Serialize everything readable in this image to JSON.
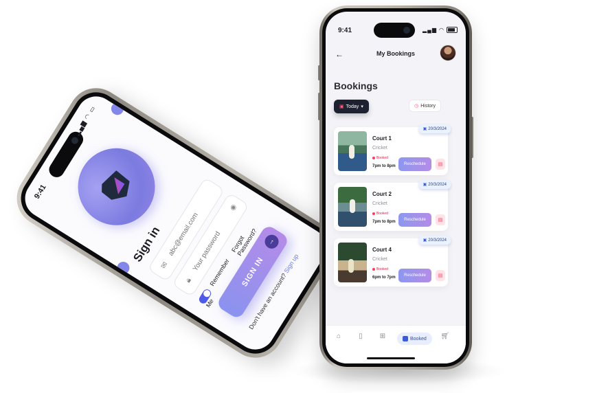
{
  "signin_screen": {
    "status_time": "9:41",
    "title": "Sign in",
    "email_placeholder": "abc@email.com",
    "password_placeholder": "Your password",
    "remember_label": "Remember Me",
    "forgot_label": "Forgot Password?",
    "signin_button": "SIGN IN",
    "no_account_text": "Don't have an account?",
    "signup_link": "Sign up"
  },
  "bookings_screen": {
    "status_time": "9:41",
    "header_title": "My Bookings",
    "section_title": "Bookings",
    "filter_today": "Today",
    "filter_history": "History",
    "bookings": [
      {
        "court": "Court 1",
        "sport": "Cricket",
        "status": "Booked",
        "time": "7pm to 8pm",
        "date": "20/3/2024",
        "action": "Reschedule"
      },
      {
        "court": "Court 2",
        "sport": "Cricket",
        "status": "Booked",
        "time": "7pm to 8pm",
        "date": "20/3/2024",
        "action": "Reschedule"
      },
      {
        "court": "Court 4",
        "sport": "Cricket",
        "status": "Booked",
        "time": "6pm to 7pm",
        "date": "20/3/2024",
        "action": "Reschedule"
      }
    ],
    "nav": {
      "active_label": "Booked",
      "icons": [
        "home-icon",
        "bookmark-icon",
        "add-icon",
        "booked-icon",
        "cart-icon"
      ]
    }
  },
  "colors": {
    "accent_gradient_start": "#8a93ef",
    "accent_gradient_end": "#b58be8",
    "status_red": "#ff3b5f",
    "dark_chip": "#1d2130"
  }
}
